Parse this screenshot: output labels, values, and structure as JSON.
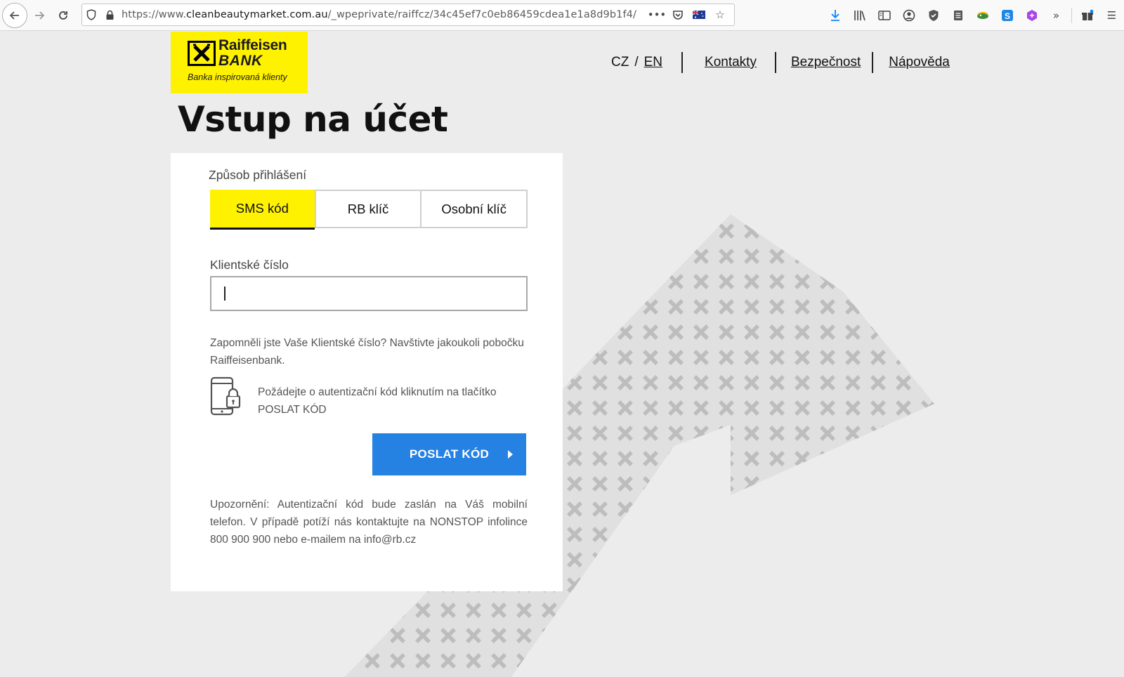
{
  "browser": {
    "url_prefix": "https://www.",
    "url_host": "cleanbeautymarket.com.au",
    "url_path": "/_wpeprivate/raiffcz/34c45ef7c0eb86459cdea1e1a8d9b1f4/"
  },
  "logo": {
    "name_line1": "Raiffeisen",
    "name_line2": "BANK",
    "tagline": "Banka inspirovaná klienty",
    "brand_color": "#fff200"
  },
  "nav": {
    "lang_cz": "CZ",
    "lang_sep": "/",
    "lang_en": "EN",
    "links": [
      "Kontakty",
      "Bezpečnost",
      "Nápověda"
    ]
  },
  "page_title": "Vstup na účet",
  "login": {
    "method_label": "Způsob přihlášení",
    "tabs": [
      "SMS kód",
      "RB klíč",
      "Osobní klíč"
    ],
    "active_tab": "SMS kód",
    "client_number_label": "Klientské číslo",
    "client_number_value": "",
    "forgot_text": "Zapomněli jste Vaše Klientské číslo? Navštivte jakoukoli pobočku Raiffeisenbank.",
    "request_text": "Požádejte o autentizační kód kliknutím na tlačítko POSLAT KÓD",
    "send_button": "POSLAT KÓD",
    "button_color": "#2581e2",
    "notice": "Upozornění: Autentizační kód bude zaslán na Váš mobilní telefon. V případě potíží nás kontaktujte na NONSTOP infolince 800 900 900 nebo e-mailem na info@rb.cz"
  }
}
